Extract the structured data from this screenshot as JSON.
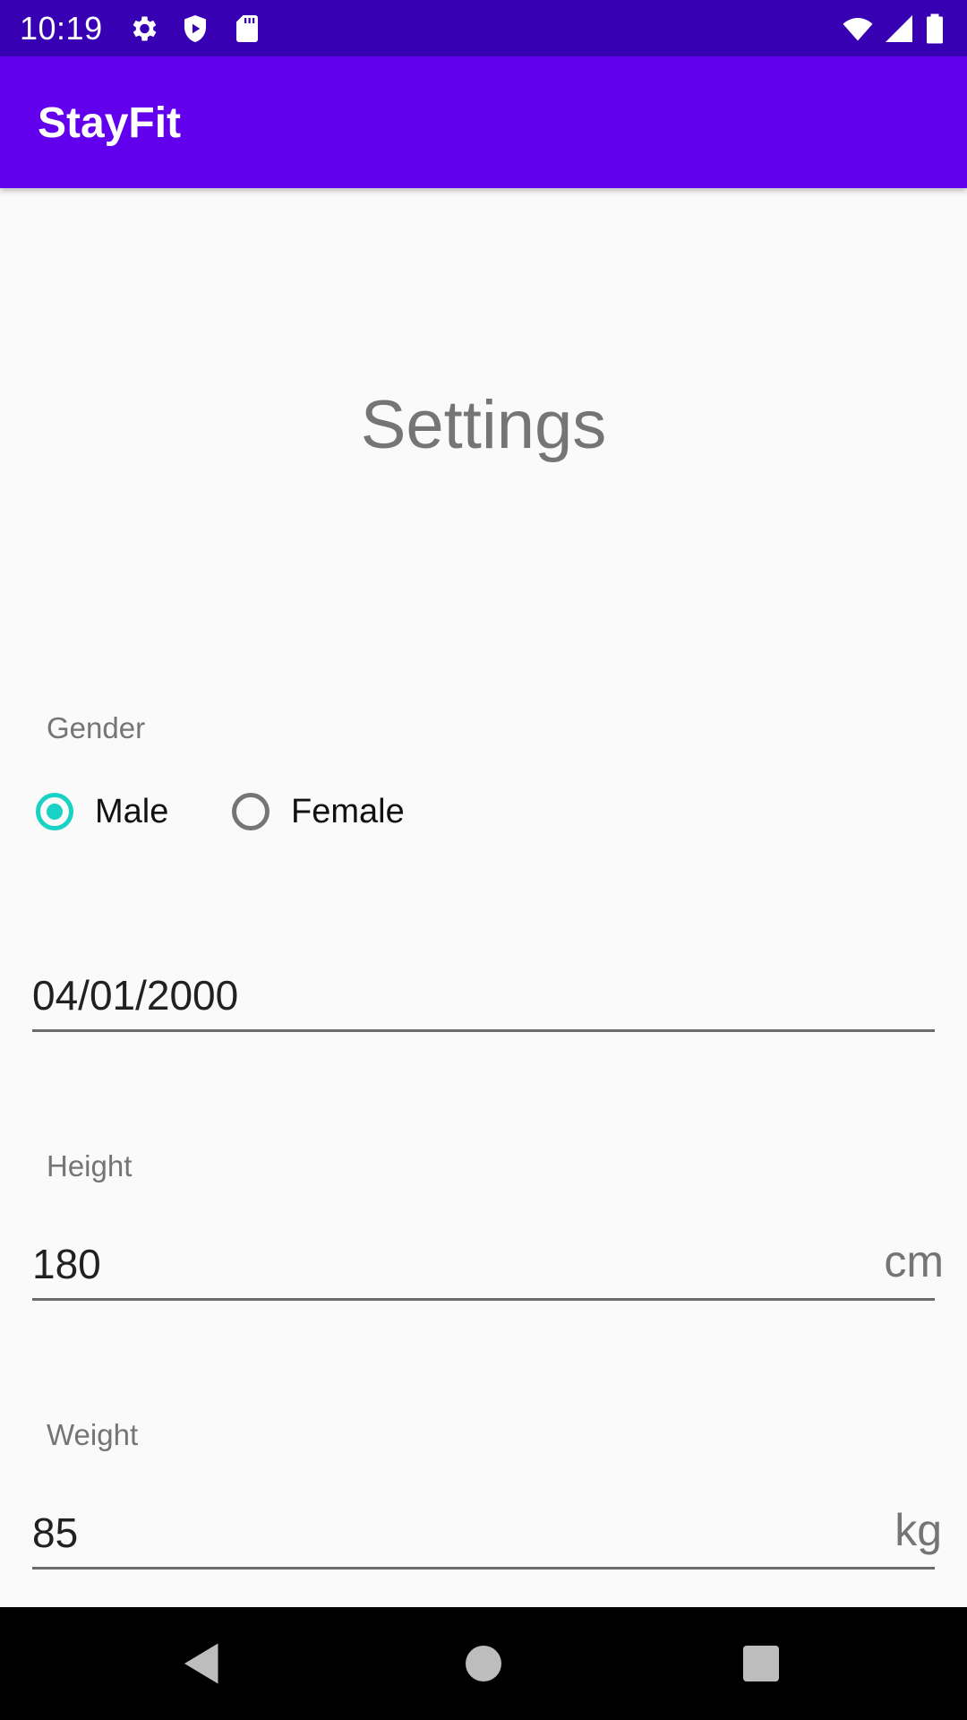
{
  "status_bar": {
    "time": "10:19",
    "left_icons": [
      "gear-icon",
      "shield-icon",
      "sd-card-icon"
    ],
    "right_icons": [
      "wifi-icon",
      "cell-signal-icon",
      "battery-icon"
    ]
  },
  "app_bar": {
    "title": "StayFit",
    "color": "#6200ee",
    "status_color": "#3700b3"
  },
  "page": {
    "title": "Settings"
  },
  "gender": {
    "label": "Gender",
    "options": [
      {
        "label": "Male",
        "checked": true
      },
      {
        "label": "Female",
        "checked": false
      }
    ],
    "accent": "#18d3c3"
  },
  "birthdate": {
    "value": "04/01/2000"
  },
  "height": {
    "label": "Height",
    "value": "180",
    "unit": "cm"
  },
  "weight": {
    "label": "Weight",
    "value": "85",
    "unit": "kg"
  },
  "nav_bar": {
    "buttons": [
      "back-icon",
      "home-icon",
      "recents-icon"
    ]
  }
}
